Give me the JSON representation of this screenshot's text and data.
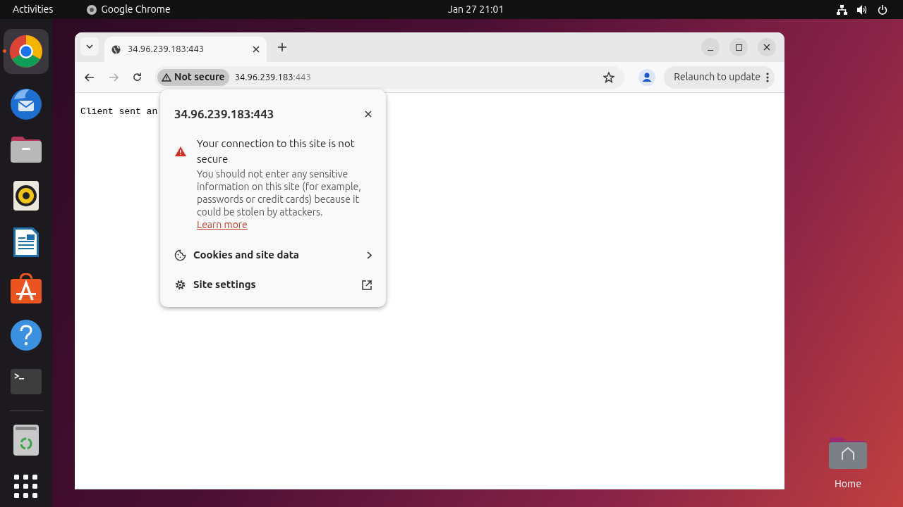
{
  "top_bar": {
    "activities": "Activities",
    "app_name": "Google Chrome",
    "clock": "Jan 27  21:01"
  },
  "dock": {
    "items": [
      {
        "kind": "chrome",
        "running": true
      },
      {
        "kind": "thunderbird",
        "running": false
      },
      {
        "kind": "files",
        "running": false
      },
      {
        "kind": "rhythmbox",
        "running": false
      },
      {
        "kind": "writer",
        "running": false
      },
      {
        "kind": "appcenter",
        "running": false
      },
      {
        "kind": "help",
        "running": false
      },
      {
        "kind": "terminal",
        "running": false
      },
      {
        "kind": "separator",
        "running": false
      },
      {
        "kind": "trash",
        "running": false
      },
      {
        "kind": "apps",
        "running": false
      }
    ]
  },
  "browser": {
    "tabs": [
      {
        "title": "34.96.239.183:443",
        "selected": true
      }
    ],
    "address": {
      "security_chip": "Not secure",
      "host": "34.96.239.183",
      "port": ":443"
    },
    "relaunch": "Relaunch to update",
    "page_text": "Client sent an",
    "popup": {
      "title": "34.96.239.183:443",
      "heading": "Your connection to this site is not secure",
      "body": "You should not enter any sensitive information on this site (for example, passwords or credit cards) because it could be stolen by attackers.",
      "link": "Learn more",
      "items": [
        {
          "kind": "cookies",
          "label": "Cookies and site data"
        },
        {
          "kind": "settings",
          "label": "Site settings"
        }
      ]
    }
  },
  "desktop_icons": [
    {
      "label": "Home"
    }
  ]
}
